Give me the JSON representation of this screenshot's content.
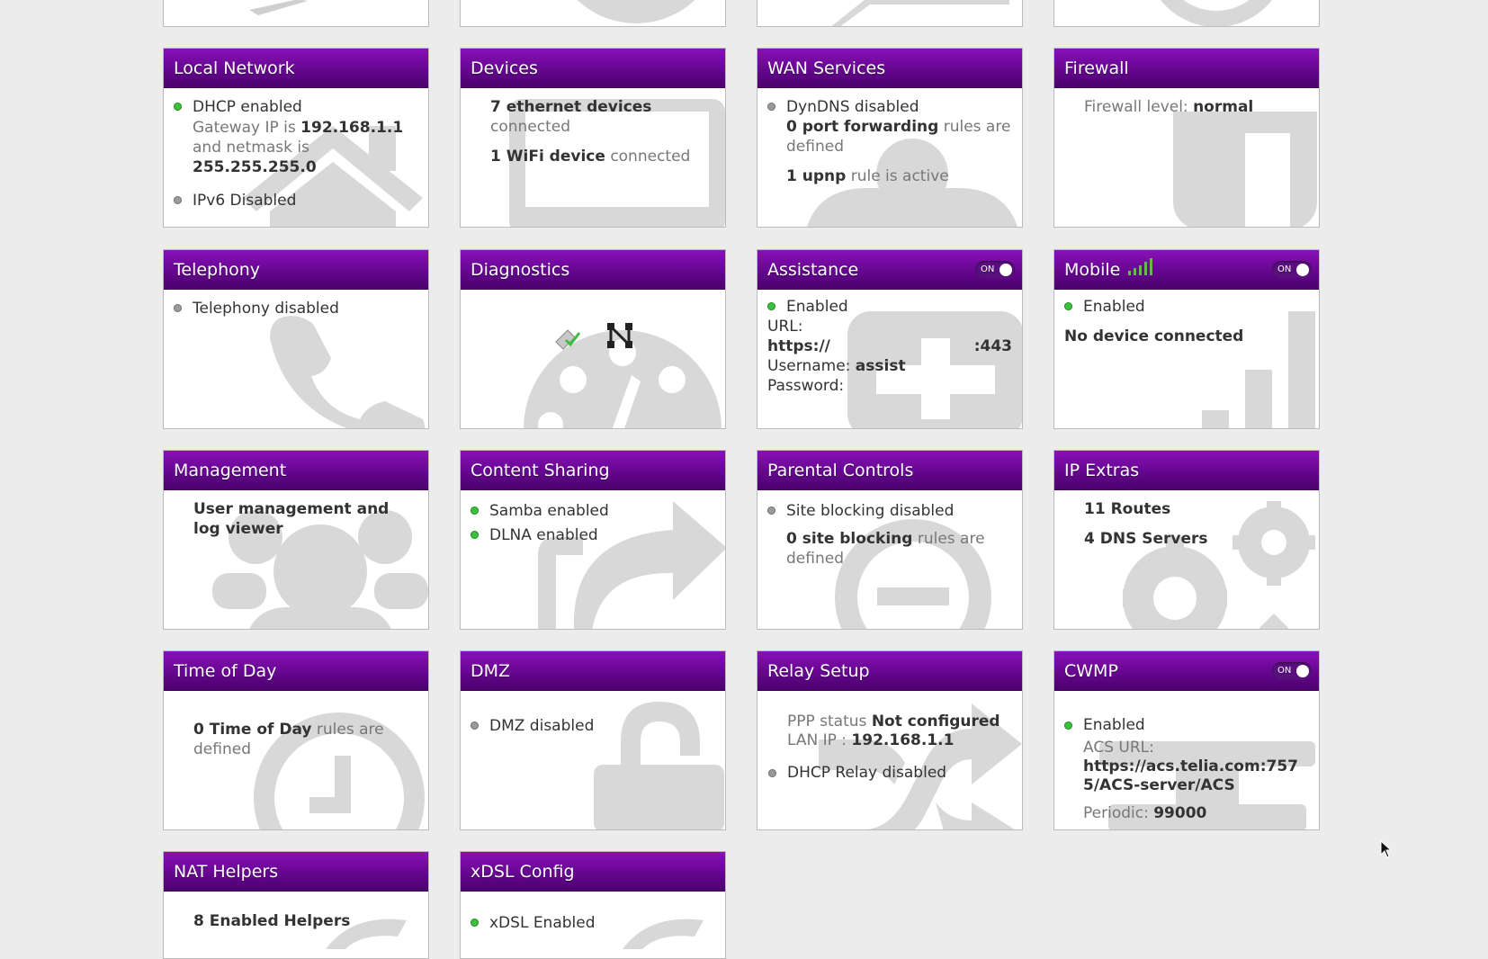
{
  "cards": {
    "local_network": {
      "title": "Local Network",
      "dhcp": "DHCP enabled",
      "gateway_prefix": "Gateway IP is",
      "gateway_ip": "192.168.1.1",
      "netmask_prefix": "and netmask is",
      "netmask": "255.255.255.0",
      "ipv6": "IPv6 Disabled",
      "icon": "home-icon"
    },
    "devices": {
      "title": "Devices",
      "ethernet_count": "7 ethernet devices",
      "ethernet_suffix": "connected",
      "wifi_count": "1 WiFi device",
      "wifi_suffix": "connected",
      "icon": "monitor-icon"
    },
    "wan_services": {
      "title": "WAN Services",
      "dyndns": "DynDNS disabled",
      "port_fwd_count": "0 port forwarding",
      "port_fwd_suffix": "rules are defined",
      "upnp_count": "1 upnp",
      "upnp_suffix": "rule is active",
      "icon": "user-icon"
    },
    "firewall": {
      "title": "Firewall",
      "level_label": "Firewall level:",
      "level": "normal",
      "icon": "shield-icon"
    },
    "telephony": {
      "title": "Telephony",
      "status": "Telephony disabled",
      "icon": "phone-icon"
    },
    "diagnostics": {
      "title": "Diagnostics",
      "icon": "dashboard-icon"
    },
    "assistance": {
      "title": "Assistance",
      "toggle": "ON",
      "status": "Enabled",
      "url_label": "URL:",
      "url_start": "https://",
      "url_end": ":443",
      "username_label": "Username:",
      "username": "assist",
      "password_label": "Password:",
      "icon": "medkit-icon"
    },
    "mobile": {
      "title": "Mobile",
      "toggle": "ON",
      "status": "Enabled",
      "device": "No device connected",
      "icon": "signal-icon"
    },
    "management": {
      "title": "Management",
      "text": "User management and log viewer",
      "icon": "group-icon"
    },
    "content_sharing": {
      "title": "Content Sharing",
      "samba": "Samba enabled",
      "dlna": "DLNA enabled",
      "icon": "share-icon"
    },
    "parental_controls": {
      "title": "Parental Controls",
      "site_blocking": "Site blocking disabled",
      "count": "0 site blocking",
      "suffix": "rules are defined",
      "icon": "minus-circle-icon"
    },
    "ip_extras": {
      "title": "IP Extras",
      "routes": "11 Routes",
      "dns": "4 DNS Servers",
      "icon": "gears-icon"
    },
    "time_of_day": {
      "title": "Time of Day",
      "count": "0 Time of Day",
      "suffix": "rules are defined",
      "icon": "clock-icon"
    },
    "dmz": {
      "title": "DMZ",
      "status": "DMZ disabled",
      "icon": "unlock-icon"
    },
    "relay_setup": {
      "title": "Relay Setup",
      "ppp_label": "PPP status",
      "ppp_status": "Not configured",
      "lan_label": "LAN IP :",
      "lan_ip": "192.168.1.1",
      "dhcp_relay": "DHCP Relay disabled",
      "icon": "shuffle-icon"
    },
    "cwmp": {
      "title": "CWMP",
      "toggle": "ON",
      "status": "Enabled",
      "acs_label": "ACS URL:",
      "acs_url": "https://acs.telia.com:7575/ACS-server/ACS",
      "periodic_label": "Periodic:",
      "periodic": "99000",
      "icon": "wrench-icon"
    },
    "nat_helpers": {
      "title": "NAT Helpers",
      "count": "8 Enabled Helpers"
    },
    "xdsl_config": {
      "title": "xDSL Config",
      "status": "xDSL Enabled"
    }
  },
  "colors": {
    "header": "#65068f",
    "enabled": "#3cbf3c",
    "disabled": "#9a9a9a",
    "bg_icon": "#d8d8d8"
  }
}
